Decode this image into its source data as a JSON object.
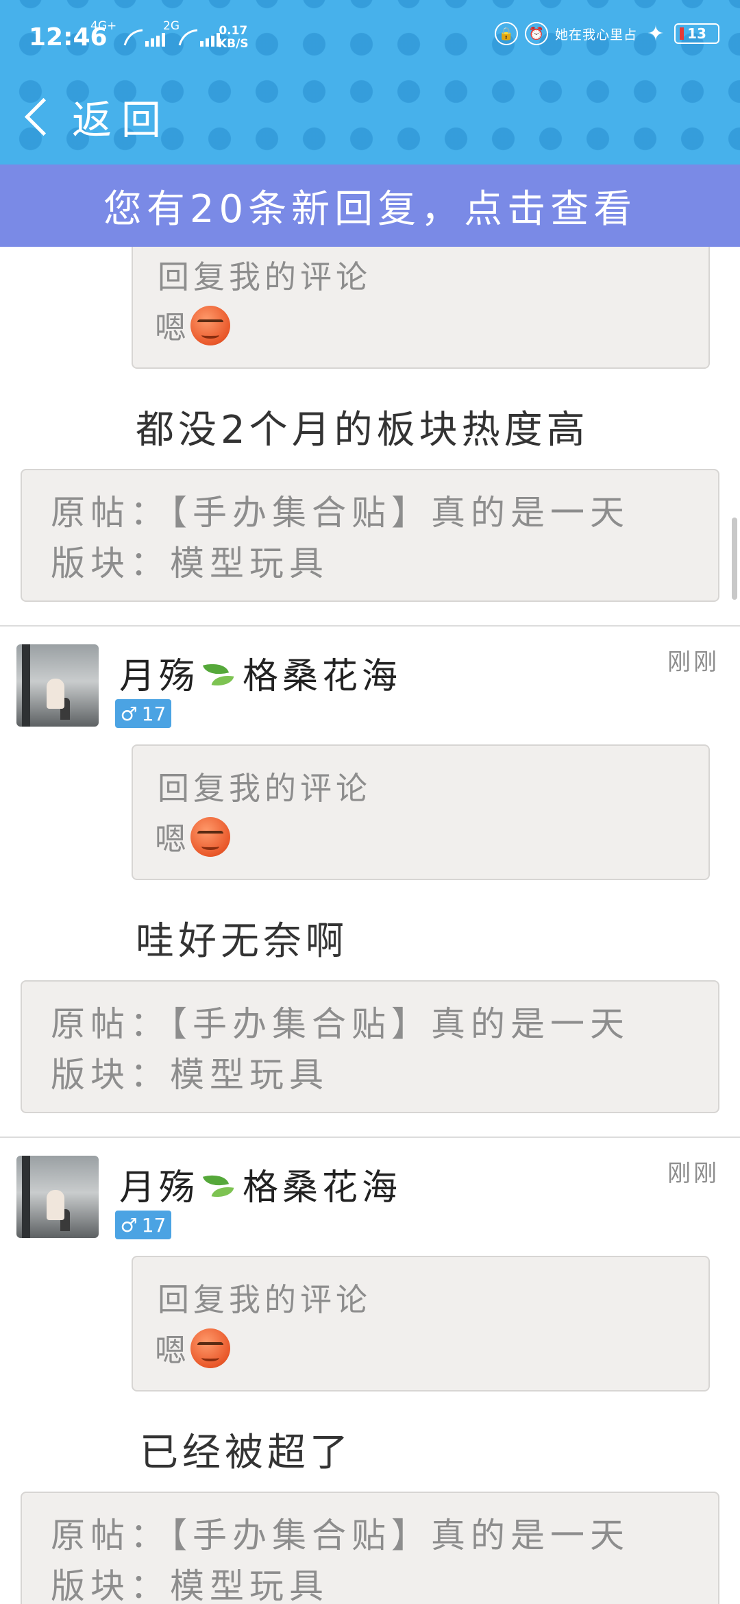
{
  "status_bar": {
    "time": "12:46",
    "net1": "4G+",
    "net2": "2G",
    "speed_value": "0.17",
    "speed_unit": "KB/S",
    "marquee": "她在我心里占",
    "battery": "13"
  },
  "nav": {
    "back_label": "返回"
  },
  "banner": {
    "text": "您有20条新回复，点击查看"
  },
  "feed": {
    "items": [
      {
        "quote_title": "回复我的评论",
        "quote_text": "嗯",
        "reply": "都没2个月的板块热度高",
        "post_line1": "原帖：【手办集合贴】真的是一天",
        "post_line2": "版块：模型玩具"
      },
      {
        "username_part1": "月殇",
        "username_part2": "格桑花海",
        "gender_level": "17",
        "time": "刚刚",
        "quote_title": "回复我的评论",
        "quote_text": "嗯",
        "reply": "哇好无奈啊",
        "post_line1": "原帖：【手办集合贴】真的是一天",
        "post_line2": "版块：模型玩具"
      },
      {
        "username_part1": "月殇",
        "username_part2": "格桑花海",
        "gender_level": "17",
        "time": "刚刚",
        "quote_title": "回复我的评论",
        "quote_text": "嗯",
        "reply": "已经被超了",
        "post_line1": "原帖：【手办集合贴】真的是一天",
        "post_line2": "版块：模型玩具"
      }
    ]
  },
  "colors": {
    "header": "#47b1eb",
    "banner": "#7a8ae6",
    "badge": "#4ba3e3"
  }
}
